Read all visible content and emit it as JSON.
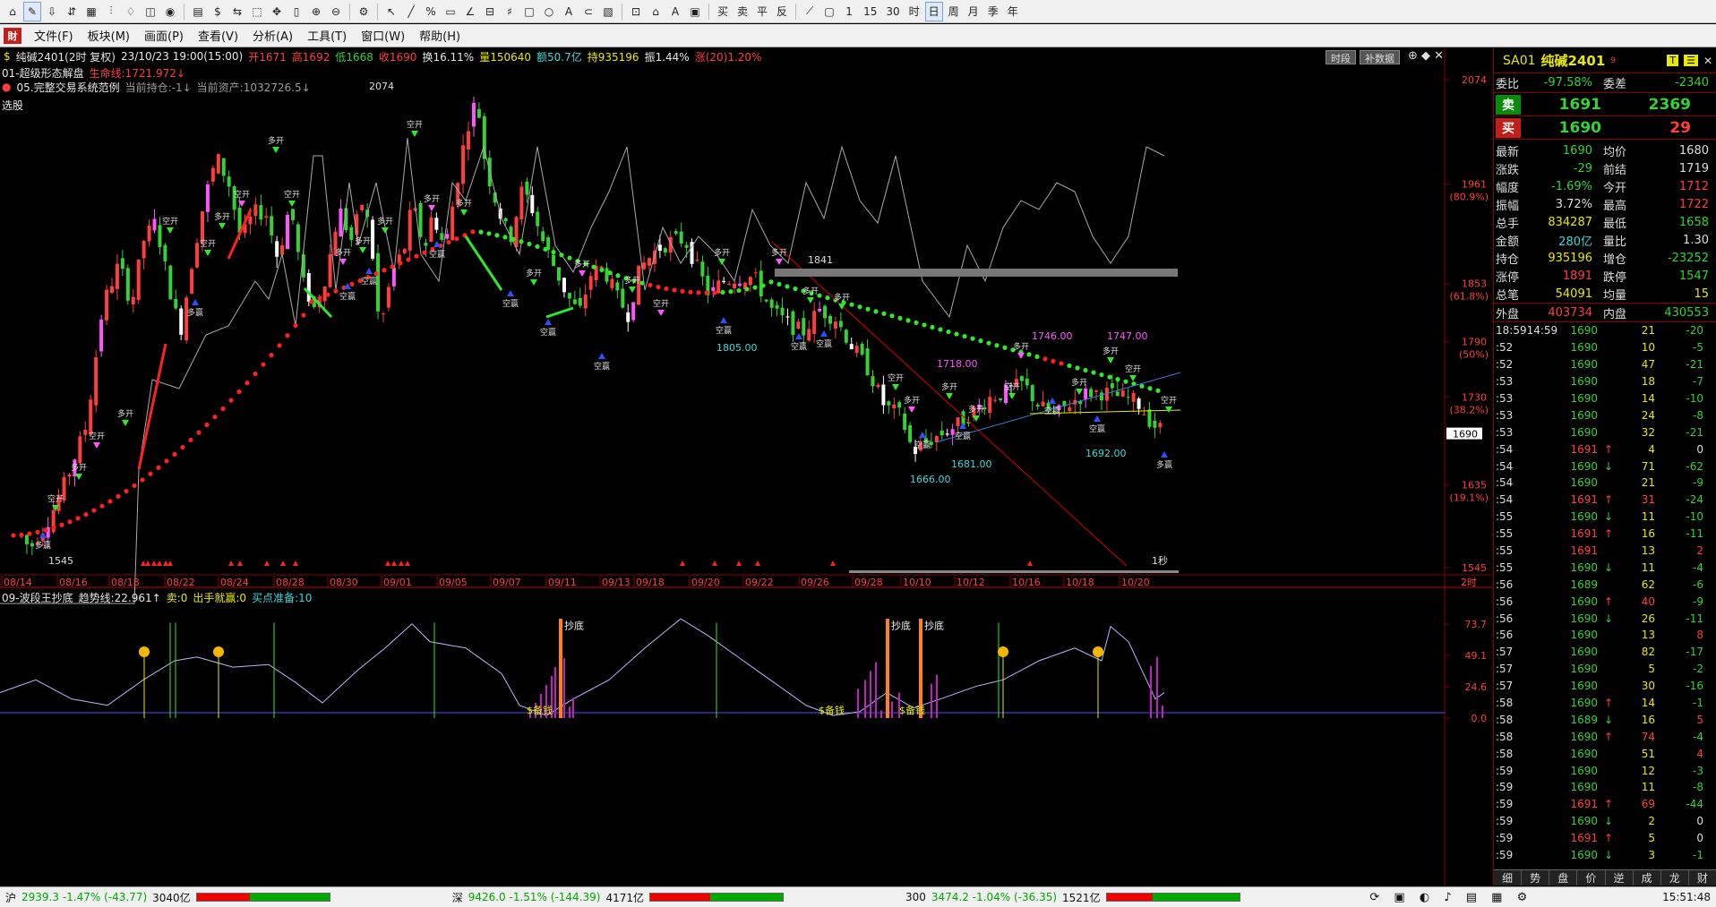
{
  "toolbar": {
    "buttons": [
      "⌂",
      "✎",
      "⇩",
      "⇵",
      "▦",
      "⫶",
      "♢",
      "◫",
      "◉",
      "▤",
      "$",
      "⇆",
      "⬚",
      "✥",
      "▯",
      "⊕",
      "⊖",
      "⚙",
      "↖",
      "╱",
      "%",
      "▭",
      "∠",
      "⊟",
      "♯",
      "□",
      "○",
      "A",
      "⊂",
      "▧",
      "⊡",
      "⌂",
      "A",
      "▣",
      "买",
      "卖",
      "平",
      "反",
      "⟋",
      "▢",
      "1",
      "15",
      "30",
      "时",
      "日",
      "周",
      "月",
      "季",
      "年"
    ],
    "active_index": [
      1,
      44
    ]
  },
  "menu": {
    "items": [
      "文件(F)",
      "板块(M)",
      "画面(P)",
      "查看(V)",
      "分析(A)",
      "工具(T)",
      "窗口(W)",
      "帮助(H)"
    ]
  },
  "chart": {
    "header": {
      "symbol": "纯碱2401(2时 复权)",
      "datetime": "23/10/23 19:00(15:00)",
      "open": "开1671",
      "high": "高1692",
      "low": "低1668",
      "close": "收1690",
      "turnover": "换16.11%",
      "volume": "量150640",
      "amount": "额50.7亿",
      "oi": "持935196",
      "amplitude": "振1.44%",
      "change": "涨(20)1.20%"
    },
    "indicator1": {
      "name": "01-超级形态解盘",
      "line": "生命线:1721.972↓"
    },
    "indicator2": {
      "name": "05.完整交易系统范例",
      "pos": "当前持仓:-1↓",
      "assets": "当前资产:1032726.5↓"
    },
    "selector_label": "选股",
    "buttons": [
      "时段",
      "补数据"
    ],
    "price_axis": [
      {
        "label": "2074",
        "pct": ""
      },
      {
        "label": "1961",
        "pct": "(80.9%)"
      },
      {
        "label": "1853",
        "pct": "(61.8%)"
      },
      {
        "label": "1790",
        "pct": "(50%)"
      },
      {
        "label": "1730",
        "pct": "(38.2%)"
      },
      {
        "label": "1690",
        "pct": ""
      },
      {
        "label": "1635",
        "pct": "(19.1%)"
      },
      {
        "label": "1545",
        "pct": ""
      }
    ],
    "annotations": [
      "2074",
      "1841",
      "1805.00",
      "1746.00",
      "1747.00",
      "1718.00",
      "1692.00",
      "1681.00",
      "1666.00",
      "1545",
      "1秒"
    ],
    "dates": [
      "08/14",
      "08/16",
      "08/18",
      "08/22",
      "08/24",
      "08/28",
      "08/30",
      "09/01",
      "09/05",
      "09/07",
      "09/11",
      "09/13",
      "09/18",
      "09/20",
      "09/22",
      "09/26",
      "09/28",
      "10/10",
      "10/12",
      "10/16",
      "10/18",
      "10/20"
    ],
    "period_tag": "2时",
    "signal_labels": [
      "多开",
      "空开",
      "多赢",
      "空赢",
      "-1",
      "1"
    ]
  },
  "sub": {
    "name": "09-波段王抄底",
    "trend": "趋势线:22.961↑",
    "sell": "卖:0",
    "exit": "出手就赢:0",
    "buy_ready": "买点准备:10",
    "axis": [
      "73.7",
      "49.1",
      "24.6",
      "0.0"
    ],
    "markers": [
      "抄底",
      "抄底",
      "抄底"
    ],
    "bottom_labels": [
      "$备钱",
      "$备钱",
      "$备钱"
    ]
  },
  "quote": {
    "code": "SA01",
    "name": "纯碱2401",
    "sup": "9",
    "weibi_label": "委比",
    "weibi": "-97.58%",
    "weicha_label": "委差",
    "weicha": "-2340",
    "sell_label": "卖",
    "sell_price": "1691",
    "sell_vol": "2369",
    "buy_label": "买",
    "buy_price": "1690",
    "buy_vol": "29",
    "rows": [
      {
        "k": "最新",
        "v": "1690",
        "vc": "#35d135",
        "k2": "均价",
        "v2": "1680",
        "v2c": "#ddd"
      },
      {
        "k": "涨跌",
        "v": "-29",
        "vc": "#35d135",
        "k2": "前结",
        "v2": "1719",
        "v2c": "#ddd"
      },
      {
        "k": "幅度",
        "v": "-1.69%",
        "vc": "#35d135",
        "k2": "今开",
        "v2": "1712",
        "v2c": "#ff3d3d"
      },
      {
        "k": "振幅",
        "v": "3.72%",
        "vc": "#ddd",
        "k2": "最高",
        "v2": "1722",
        "v2c": "#ff3d3d"
      },
      {
        "k": "总手",
        "v": "834287",
        "vc": "#e8e800",
        "k2": "最低",
        "v2": "1658",
        "v2c": "#35d135"
      },
      {
        "k": "金额",
        "v": "280亿",
        "vc": "#3fd8d8",
        "k2": "量比",
        "v2": "1.30",
        "v2c": "#ddd"
      },
      {
        "k": "持仓",
        "v": "935196",
        "vc": "#e8e800",
        "k2": "增仓",
        "v2": "-23252",
        "v2c": "#35d135"
      },
      {
        "k": "涨停",
        "v": "1891",
        "vc": "#ff3d3d",
        "k2": "跌停",
        "v2": "1547",
        "v2c": "#35d135"
      },
      {
        "k": "总笔",
        "v": "54091",
        "vc": "#e8e800",
        "k2": "均量",
        "v2": "15",
        "v2c": "#e8e800"
      }
    ],
    "outer_label": "外盘",
    "outer": "403734",
    "inner_label": "内盘",
    "inner": "430553",
    "ticks": [
      {
        "t": "18:59",
        "p": "14:59",
        "price": "1690",
        "ar": "",
        "vol": "21",
        "ch": "-20"
      },
      {
        "t": ":52",
        "p": "",
        "price": "1690",
        "ar": "",
        "vol": "10",
        "ch": "-5"
      },
      {
        "t": ":52",
        "p": "",
        "price": "1690",
        "ar": "",
        "vol": "47",
        "ch": "-21"
      },
      {
        "t": ":53",
        "p": "",
        "price": "1690",
        "ar": "",
        "vol": "18",
        "ch": "-7"
      },
      {
        "t": ":53",
        "p": "",
        "price": "1690",
        "ar": "",
        "vol": "14",
        "ch": "-10"
      },
      {
        "t": ":53",
        "p": "",
        "price": "1690",
        "ar": "",
        "vol": "24",
        "ch": "-8"
      },
      {
        "t": ":53",
        "p": "",
        "price": "1690",
        "ar": "",
        "vol": "32",
        "ch": "-21"
      },
      {
        "t": ":54",
        "p": "",
        "price": "1691",
        "ar": "↑",
        "vol": "4",
        "ch": "0"
      },
      {
        "t": ":54",
        "p": "",
        "price": "1690",
        "ar": "↓",
        "vol": "71",
        "ch": "-62"
      },
      {
        "t": ":54",
        "p": "",
        "price": "1690",
        "ar": "",
        "vol": "21",
        "ch": "-9"
      },
      {
        "t": ":54",
        "p": "",
        "price": "1691",
        "ar": "↑",
        "vol": "31",
        "ch": "-24"
      },
      {
        "t": ":55",
        "p": "",
        "price": "1690",
        "ar": "↓",
        "vol": "11",
        "ch": "-10"
      },
      {
        "t": ":55",
        "p": "",
        "price": "1691",
        "ar": "↑",
        "vol": "16",
        "ch": "-11"
      },
      {
        "t": ":55",
        "p": "",
        "price": "1691",
        "ar": "",
        "vol": "13",
        "ch": "2"
      },
      {
        "t": ":55",
        "p": "",
        "price": "1690",
        "ar": "↓",
        "vol": "11",
        "ch": "-4"
      },
      {
        "t": ":56",
        "p": "",
        "price": "1689",
        "ar": "",
        "vol": "62",
        "ch": "-6"
      },
      {
        "t": ":56",
        "p": "",
        "price": "1690",
        "ar": "↑",
        "vol": "40",
        "ch": "-9"
      },
      {
        "t": ":56",
        "p": "",
        "price": "1690",
        "ar": "↓",
        "vol": "26",
        "ch": "-11"
      },
      {
        "t": ":56",
        "p": "",
        "price": "1690",
        "ar": "",
        "vol": "13",
        "ch": "8"
      },
      {
        "t": ":57",
        "p": "",
        "price": "1690",
        "ar": "",
        "vol": "82",
        "ch": "-17"
      },
      {
        "t": ":57",
        "p": "",
        "price": "1690",
        "ar": "",
        "vol": "5",
        "ch": "-2"
      },
      {
        "t": ":57",
        "p": "",
        "price": "1690",
        "ar": "",
        "vol": "30",
        "ch": "-16"
      },
      {
        "t": ":58",
        "p": "",
        "price": "1690",
        "ar": "↑",
        "vol": "14",
        "ch": "-1"
      },
      {
        "t": ":58",
        "p": "",
        "price": "1689",
        "ar": "↓",
        "vol": "16",
        "ch": "5"
      },
      {
        "t": ":58",
        "p": "",
        "price": "1690",
        "ar": "↑",
        "vol": "74",
        "ch": "-4"
      },
      {
        "t": ":58",
        "p": "",
        "price": "1690",
        "ar": "",
        "vol": "51",
        "ch": "4"
      },
      {
        "t": ":59",
        "p": "",
        "price": "1690",
        "ar": "",
        "vol": "12",
        "ch": "-3"
      },
      {
        "t": ":59",
        "p": "",
        "price": "1690",
        "ar": "",
        "vol": "11",
        "ch": "-8"
      },
      {
        "t": ":59",
        "p": "",
        "price": "1691",
        "ar": "↑",
        "vol": "69",
        "ch": "-44"
      },
      {
        "t": ":59",
        "p": "",
        "price": "1690",
        "ar": "↓",
        "vol": "2",
        "ch": "0"
      },
      {
        "t": ":59",
        "p": "",
        "price": "1691",
        "ar": "↑",
        "vol": "5",
        "ch": "0"
      },
      {
        "t": ":59",
        "p": "",
        "price": "1690",
        "ar": "↓",
        "vol": "3",
        "ch": "-1"
      }
    ],
    "tabs": [
      "细",
      "势",
      "盘",
      "价",
      "逆",
      "成",
      "龙",
      "财"
    ]
  },
  "status": {
    "sh_label": "沪",
    "sh": "2939.3 -1.47% (-43.77)",
    "sh_amt": "3040亿",
    "sz_label": "深",
    "sz": "9426.0 -1.51% (-144.39)",
    "sz_amt": "4171亿",
    "hs_label": "300",
    "hs": "3474.2 -1.04% (-36.35)",
    "hs_amt": "1521亿",
    "time": "15:51:48"
  },
  "colors": {
    "up": "#ff3d3d",
    "down": "#35d135",
    "bg": "#000000",
    "grid": "#800000"
  }
}
